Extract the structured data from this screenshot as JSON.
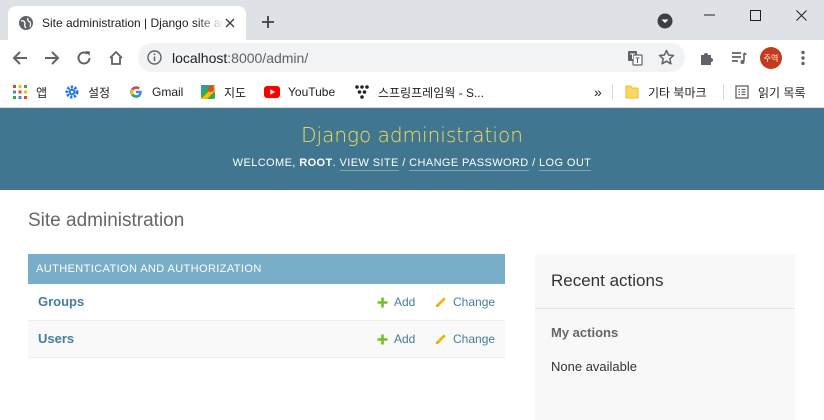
{
  "browser": {
    "tab": {
      "title": "Site administration | Django site admin"
    },
    "address": {
      "host": "localhost",
      "path": ":8000/admin/"
    },
    "profile_initials": "주역",
    "bookmarks": [
      {
        "label": "앱",
        "icon": "apps-grid-icon"
      },
      {
        "label": "설정",
        "icon": "settings-gear-icon"
      },
      {
        "label": "Gmail",
        "icon": "google-g-icon"
      },
      {
        "label": "지도",
        "icon": "maps-icon"
      },
      {
        "label": "YouTube",
        "icon": "youtube-icon"
      },
      {
        "label": "스프링프레임웍 - S...",
        "icon": "spring-icon"
      }
    ],
    "more_bookmarks": "»",
    "other_bookmarks": "기타 북마크",
    "reading_list": "읽기 목록"
  },
  "admin": {
    "branding": "Django administration",
    "usertools": {
      "welcome": "WELCOME, ",
      "user": "ROOT",
      "after_user": ". ",
      "view_site": "VIEW SITE",
      "sep": " / ",
      "change_password": "CHANGE PASSWORD",
      "log_out": "LOG OUT"
    },
    "page_title": "Site administration",
    "module": {
      "caption": "AUTHENTICATION AND AUTHORIZATION",
      "rows": [
        {
          "name": "Groups",
          "add": "Add",
          "change": "Change"
        },
        {
          "name": "Users",
          "add": "Add",
          "change": "Change"
        }
      ]
    },
    "recent": {
      "title": "Recent actions",
      "subtitle": "My actions",
      "empty": "None available"
    }
  },
  "colors": {
    "header_bg": "#417690",
    "branding": "#f5dd5d",
    "caption_bg": "#79aec8",
    "link": "#447e9b",
    "add_icon": "#70bf2b",
    "change_icon": "#efb80b"
  }
}
